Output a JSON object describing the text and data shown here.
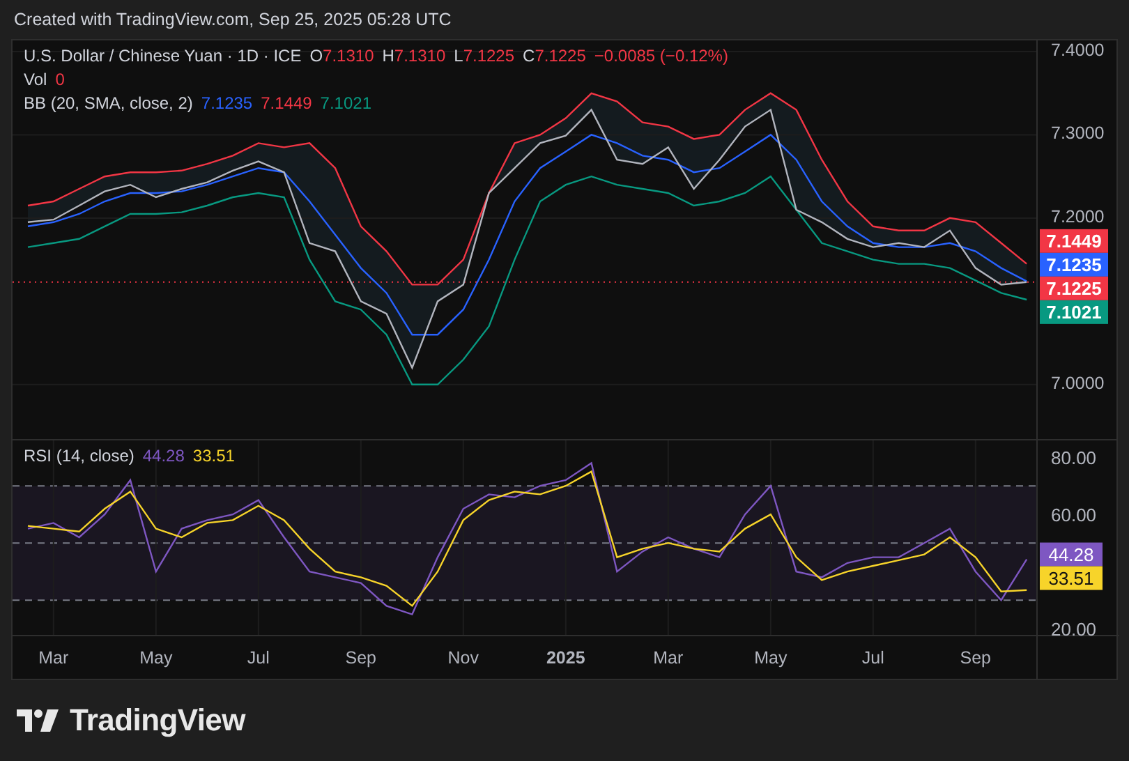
{
  "header": {
    "text": "Created with TradingView.com, Sep 25, 2025 05:28 UTC"
  },
  "legend": {
    "title": "U.S. Dollar / Chinese Yuan · 1D · ICE",
    "ohlc": [
      {
        "label": "O",
        "value": "7.1310"
      },
      {
        "label": "H",
        "value": "7.1310"
      },
      {
        "label": "L",
        "value": "7.1225"
      },
      {
        "label": "C",
        "value": "7.1225"
      }
    ],
    "change": "−0.0085 (−0.12%)",
    "volume": {
      "label": "Vol",
      "value": "0"
    },
    "bb": {
      "label": "BB (20, SMA, close, 2)",
      "values": [
        {
          "text": "7.1235",
          "color": "#2962ff"
        },
        {
          "text": "7.1449",
          "color": "#f23645"
        },
        {
          "text": "7.1021",
          "color": "#089981"
        }
      ]
    }
  },
  "price_badges": [
    {
      "text": "7.1449",
      "color": "#f23645"
    },
    {
      "text": "7.1235",
      "color": "#2962ff"
    },
    {
      "text": "7.1225",
      "color": "#f23645"
    },
    {
      "text": "7.1021",
      "color": "#089981"
    }
  ],
  "price_chart": {
    "chart_data": {
      "type": "line",
      "categories": [
        null,
        null,
        null,
        null,
        null,
        null,
        null,
        null,
        null,
        null,
        null,
        null,
        null,
        null,
        null,
        null,
        null,
        null,
        null,
        null,
        null,
        null,
        null,
        null,
        null,
        null,
        null,
        null,
        null,
        null,
        null,
        null,
        null,
        null,
        null,
        null,
        null,
        null,
        null,
        null
      ],
      "ylim": [
        6.9345,
        7.4134
      ],
      "grid": true,
      "yticks": [
        {
          "value": 7.0,
          "label": "7.0000"
        },
        {
          "value": 7.2,
          "label": "7.2000"
        },
        {
          "value": 7.3,
          "label": "7.3000"
        },
        {
          "value": 7.4,
          "label": "7.4000"
        }
      ],
      "series": [
        {
          "color": "#f23645",
          "values": [
            7.215,
            7.22,
            7.235,
            7.25,
            7.255,
            7.255,
            7.257,
            7.265,
            7.275,
            7.29,
            7.285,
            7.29,
            7.26,
            7.19,
            7.16,
            7.12,
            7.12,
            7.15,
            7.23,
            7.29,
            7.3,
            7.32,
            7.35,
            7.34,
            7.315,
            7.31,
            7.295,
            7.3,
            7.33,
            7.35,
            7.33,
            7.27,
            7.22,
            7.19,
            7.185,
            7.185,
            7.2,
            7.195,
            7.17,
            7.145
          ]
        },
        {
          "color": "#2962ff",
          "values": [
            7.19,
            7.195,
            7.205,
            7.22,
            7.23,
            7.23,
            7.232,
            7.24,
            7.25,
            7.26,
            7.255,
            7.22,
            7.18,
            7.14,
            7.11,
            7.06,
            7.06,
            7.09,
            7.15,
            7.22,
            7.26,
            7.28,
            7.3,
            7.29,
            7.275,
            7.27,
            7.255,
            7.26,
            7.28,
            7.3,
            7.27,
            7.22,
            7.19,
            7.17,
            7.165,
            7.165,
            7.17,
            7.16,
            7.14,
            7.124
          ]
        },
        {
          "color": "#089981",
          "values": [
            7.165,
            7.17,
            7.175,
            7.19,
            7.205,
            7.205,
            7.207,
            7.215,
            7.225,
            7.23,
            7.225,
            7.15,
            7.1,
            7.09,
            7.06,
            7.0,
            7.0,
            7.03,
            7.07,
            7.15,
            7.22,
            7.24,
            7.25,
            7.24,
            7.235,
            7.23,
            7.215,
            7.22,
            7.23,
            7.25,
            7.21,
            7.17,
            7.16,
            7.15,
            7.145,
            7.145,
            7.14,
            7.125,
            7.11,
            7.102
          ]
        },
        {
          "color": "#b2b5be",
          "values": [
            7.195,
            7.198,
            7.215,
            7.232,
            7.24,
            7.225,
            7.235,
            7.243,
            7.257,
            7.268,
            7.255,
            7.17,
            7.16,
            7.1,
            7.085,
            7.02,
            7.1,
            7.12,
            7.23,
            7.26,
            7.29,
            7.299,
            7.33,
            7.27,
            7.265,
            7.285,
            7.235,
            7.27,
            7.31,
            7.33,
            7.21,
            7.195,
            7.175,
            7.165,
            7.17,
            7.165,
            7.185,
            7.14,
            7.12,
            7.123
          ]
        }
      ]
    }
  },
  "rsi": {
    "label": "RSI (14, close)",
    "values": [
      {
        "text": "44.28",
        "color": "#7e57c2"
      },
      {
        "text": "33.51",
        "color": "#f7d42a"
      }
    ],
    "badges": [
      {
        "text": "44.28",
        "color": "#7e57c2"
      },
      {
        "text": "33.51",
        "color": "#f7d42a"
      }
    ],
    "chart_data": {
      "type": "line",
      "categories": [
        null,
        "Mar",
        null,
        null,
        null,
        "May",
        null,
        null,
        null,
        "Jul",
        null,
        null,
        null,
        "Sep",
        null,
        null,
        null,
        "Nov",
        null,
        null,
        null,
        "2025",
        null,
        null,
        null,
        "Mar",
        null,
        null,
        null,
        "May",
        null,
        null,
        null,
        "Jul",
        null,
        null,
        null,
        "Sep",
        null,
        null
      ],
      "ylim": [
        17.6,
        85.9
      ],
      "grid": true,
      "yticks": [
        {
          "value": 20,
          "label": "20.00"
        },
        {
          "value": 60,
          "label": "60.00"
        },
        {
          "value": 80,
          "label": "80.00"
        }
      ],
      "series": [
        {
          "color": "#7e57c2",
          "values": [
            55,
            57,
            52,
            60,
            72,
            40,
            55,
            58,
            60,
            65,
            52,
            40,
            38,
            36,
            28,
            25,
            45,
            62,
            67,
            66,
            70,
            72,
            78,
            40,
            47,
            52,
            48,
            45,
            60,
            70,
            40,
            38,
            43,
            45,
            45,
            50,
            55,
            40,
            30,
            44.3
          ]
        },
        {
          "color": "#f7d42a",
          "values": [
            56,
            55,
            54,
            62,
            68,
            55,
            52,
            57,
            58,
            63,
            58,
            48,
            40,
            38,
            35,
            28,
            40,
            58,
            65,
            68,
            67,
            70,
            75,
            45,
            48,
            50,
            48,
            47,
            55,
            60,
            45,
            37,
            40,
            42,
            44,
            46,
            52,
            45,
            33,
            33.5
          ]
        }
      ]
    }
  },
  "footer": {
    "brand": "TradingView"
  }
}
